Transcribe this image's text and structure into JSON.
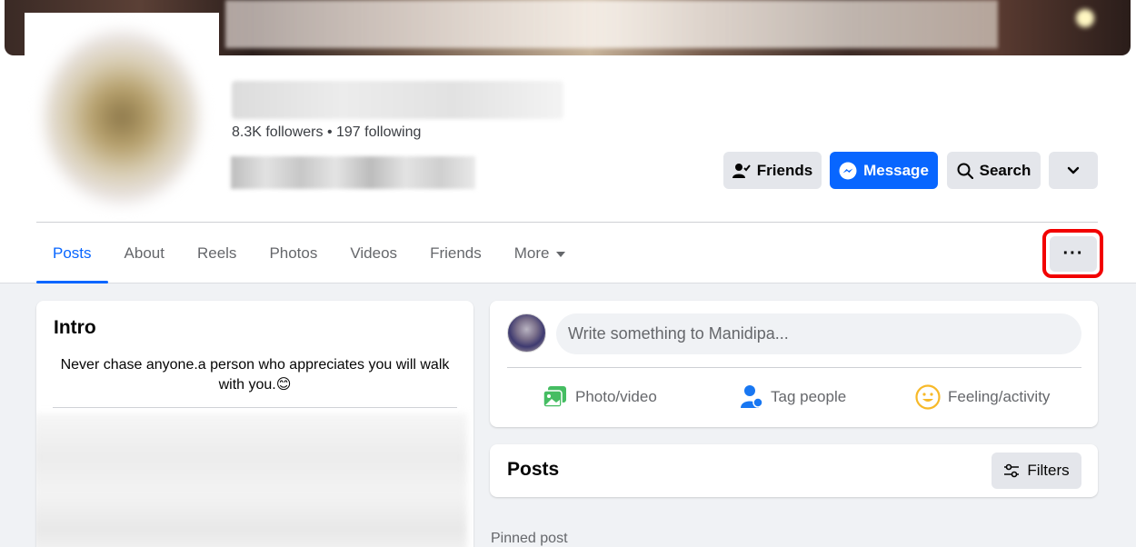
{
  "profile": {
    "followers_text": "8.3K followers • 197 following"
  },
  "actions": {
    "friends_label": "Friends",
    "message_label": "Message",
    "search_label": "Search"
  },
  "tabs": [
    {
      "label": "Posts",
      "active": true
    },
    {
      "label": "About"
    },
    {
      "label": "Reels"
    },
    {
      "label": "Photos"
    },
    {
      "label": "Videos"
    },
    {
      "label": "Friends"
    },
    {
      "label": "More"
    }
  ],
  "more_options_label": "···",
  "intro": {
    "title": "Intro",
    "bio": "Never chase anyone.a person who appreciates you will walk with you.😊"
  },
  "composer": {
    "placeholder": "Write something to Manidipa...",
    "actions": {
      "photo_video": "Photo/video",
      "tag_people": "Tag people",
      "feeling_activity": "Feeling/activity"
    }
  },
  "posts": {
    "title": "Posts",
    "filters_label": "Filters",
    "pinned_label": "Pinned post"
  },
  "colors": {
    "accent": "#0866ff",
    "highlight": "#f20000",
    "photo_icon": "#45bd62",
    "tag_icon": "#1877f2",
    "feeling_icon": "#f7b928"
  },
  "icons": {
    "friends": "person-check-icon",
    "message": "messenger-icon",
    "search": "search-icon",
    "dropdown": "chevron-down-icon",
    "more": "ellipsis-icon",
    "photo": "photo-icon",
    "tag": "tag-people-icon",
    "feeling": "smiley-icon",
    "filters": "sliders-icon"
  }
}
